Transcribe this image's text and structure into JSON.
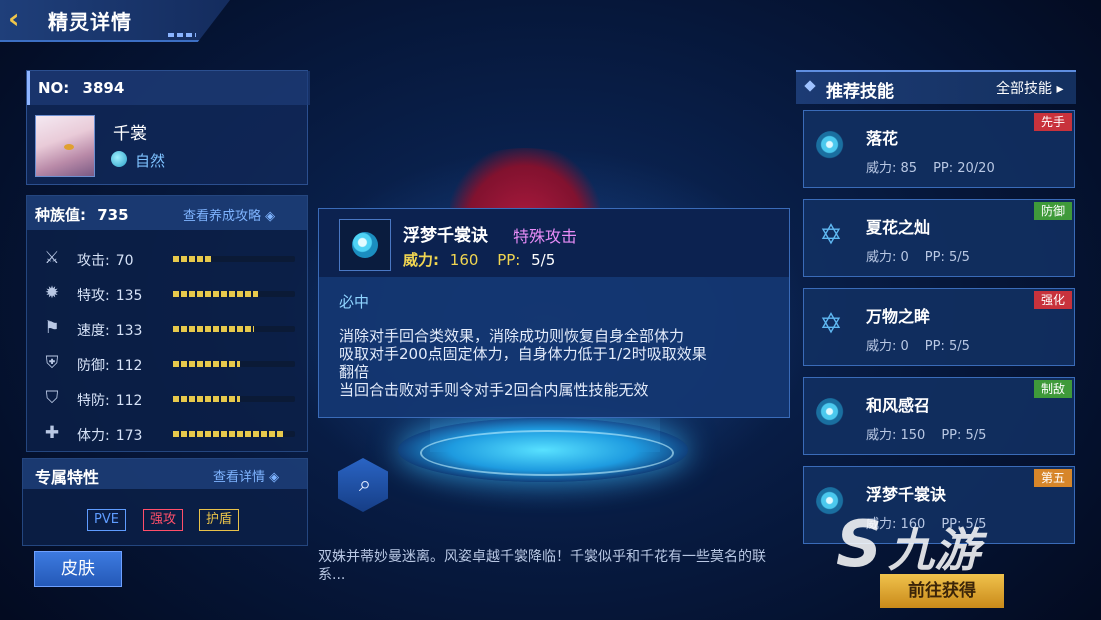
{
  "header": {
    "title": "精灵详情"
  },
  "pet": {
    "no_label": "NO:",
    "no_value": "3894",
    "name": "千裳",
    "element": "自然"
  },
  "stats": {
    "race_label": "种族值:",
    "race_value": "735",
    "guide_link": "查看养成攻略",
    "rows": [
      {
        "label": "攻击:",
        "value": "70",
        "fill": 0.33,
        "icon": "sword-icon"
      },
      {
        "label": "特攻:",
        "value": "135",
        "fill": 0.7,
        "icon": "flame-icon"
      },
      {
        "label": "速度:",
        "value": "133",
        "fill": 0.66,
        "icon": "boot-icon"
      },
      {
        "label": "防御:",
        "value": "112",
        "fill": 0.55,
        "icon": "shield-icon"
      },
      {
        "label": "特防:",
        "value": "112",
        "fill": 0.55,
        "icon": "special-shield-icon"
      },
      {
        "label": "体力:",
        "value": "173",
        "fill": 0.9,
        "icon": "bandage-icon"
      }
    ]
  },
  "traits": {
    "title": "专属特性",
    "link": "查看详情",
    "tags": [
      {
        "label": "PVE",
        "color": "#5f9cff"
      },
      {
        "label": "强攻",
        "color": "#ff4f6a"
      },
      {
        "label": "护盾",
        "color": "#e8c24a"
      }
    ]
  },
  "skin_button": "皮肤",
  "description": "双姝并蒂妙曼迷离。风姿卓越千裳降临！千裳似乎和千花有一些莫名的联系...",
  "popup": {
    "name": "浮梦千裳诀",
    "category": "特殊攻击",
    "power_label": "威力:",
    "power_value": "160",
    "pp_label": "PP:",
    "pp_value": "5/5",
    "must_hit": "必中",
    "text": "消除对手回合类效果，消除成功则恢复自身全部体力\n吸取对手200点固定体力，自身体力低于1/2时吸取效果\n翻倍\n当回合击败对手则令对手2回合内属性技能无效"
  },
  "recommend": {
    "title": "推荐技能",
    "all_link": "全部技能",
    "skills": [
      {
        "name": "落花",
        "power": "威力: 85",
        "pp": "PP:  20/20",
        "badge": "先手",
        "badge_color": "#c8323c",
        "icon": "swirl-icon"
      },
      {
        "name": "夏花之灿",
        "power": "威力: 0",
        "pp": "PP:  5/5",
        "badge": "防御",
        "badge_color": "#3f9a3a",
        "icon": "star-icon"
      },
      {
        "name": "万物之眸",
        "power": "威力: 0",
        "pp": "PP:  5/5",
        "badge": "强化",
        "badge_color": "#c8323c",
        "icon": "star-icon"
      },
      {
        "name": "和风感召",
        "power": "威力: 150",
        "pp": "PP:  5/5",
        "badge": "制敌",
        "badge_color": "#3f9a3a",
        "icon": "swirl-icon"
      },
      {
        "name": "浮梦千裳诀",
        "power": "威力: 160",
        "pp": "PP:  5/5",
        "badge": "第五",
        "badge_color": "#d7862a",
        "icon": "swirl-icon"
      }
    ]
  },
  "goto_button": "前往获得",
  "watermark": "九游"
}
